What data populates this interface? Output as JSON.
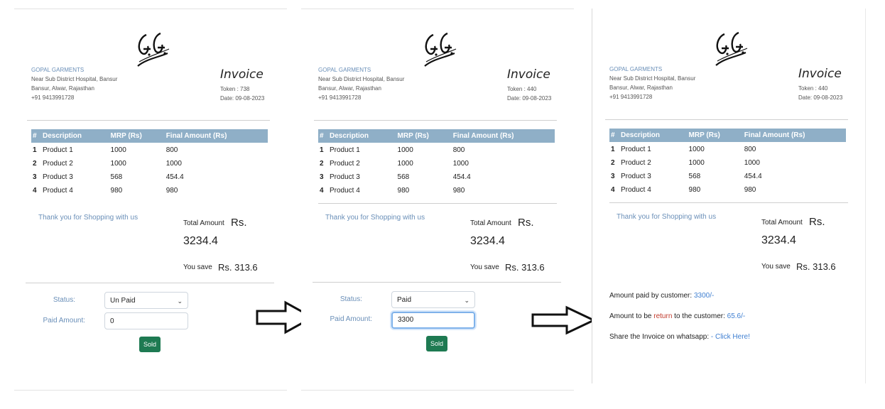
{
  "shop": {
    "name": "GOPAL GARMENTS",
    "address_line1": "Near Sub District Hospital, Bansur",
    "address_line2": "Bansur, Alwar, Rajasthan",
    "phone": "+91 9413991728"
  },
  "invoice": {
    "title": "Invoice",
    "token_label": "Token :",
    "token_p1": "738",
    "token_p2": "440",
    "token_p3": "440",
    "date_label": "Date:",
    "date": "09-08-2023"
  },
  "table": {
    "headers": [
      "#",
      "Description",
      "MRP (Rs)",
      "Final Amount (Rs)"
    ],
    "rows": [
      [
        "1",
        "Product 1",
        "1000",
        "800"
      ],
      [
        "2",
        "Product 2",
        "1000",
        "1000"
      ],
      [
        "3",
        "Product 3",
        "568",
        "454.4"
      ],
      [
        "4",
        "Product 4",
        "980",
        "980"
      ]
    ]
  },
  "summary": {
    "thanks": "Thank you for Shopping with us",
    "total_label": "Total Amount",
    "currency": "Rs.",
    "total_value": "3234.4",
    "save_label": "You save",
    "save_value": "Rs. 313.6"
  },
  "form": {
    "status_label": "Status:",
    "paid_label": "Paid Amount:",
    "status_p1": "Un Paid",
    "status_p2": "Paid",
    "paid_p1": "0",
    "paid_p2": "3300",
    "sold_label": "Sold",
    "chevron": "⌄"
  },
  "result": {
    "paid_label": "Amount paid by customer:",
    "paid_value": "3300/-",
    "return_prefix": "Amount to be ",
    "return_word": "return",
    "return_suffix": " to the customer:",
    "return_value": "65.6/-",
    "share_label": "Share the Invoice on whatsapp:",
    "share_link": "- Click Here!"
  },
  "colors": {
    "table_header": "#8fafc7",
    "accent_blue": "#6a8fb8",
    "sold_button": "#1e7a52",
    "link": "#3f7fd1"
  }
}
